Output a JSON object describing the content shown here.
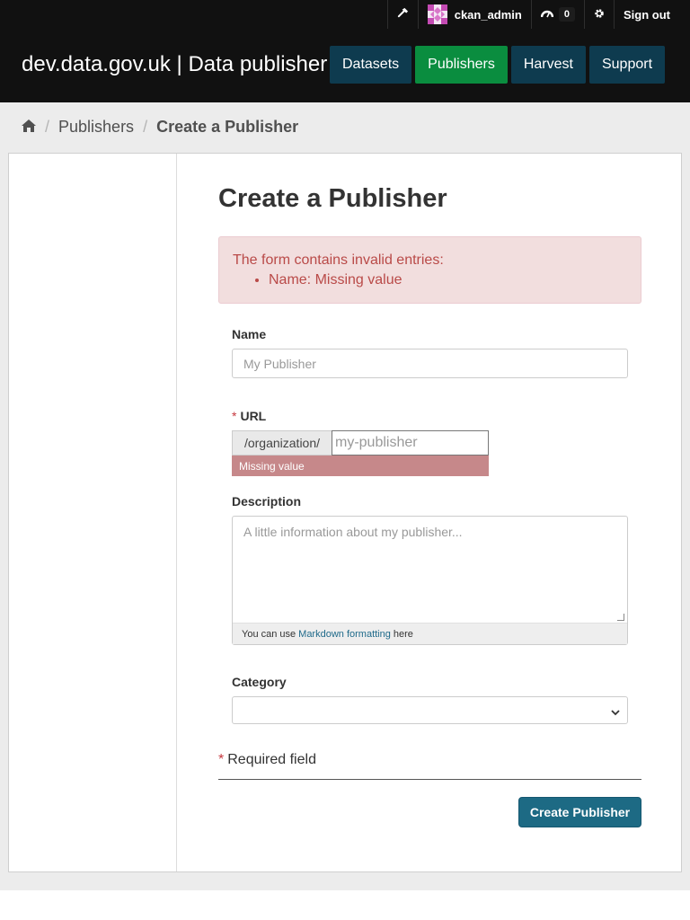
{
  "account": {
    "username": "ckan_admin",
    "activity_count": "0",
    "signout_label": "Sign out"
  },
  "site": {
    "title": "dev.data.gov.uk | Data publisher"
  },
  "nav": {
    "items": [
      {
        "label": "Datasets"
      },
      {
        "label": "Publishers"
      },
      {
        "label": "Harvest"
      },
      {
        "label": "Support"
      }
    ],
    "active_index": 1
  },
  "breadcrumb": {
    "items": [
      "Publishers",
      "Create a Publisher"
    ]
  },
  "page": {
    "heading": "Create a Publisher"
  },
  "alert": {
    "message": "The form contains invalid entries:",
    "errors": [
      "Name: Missing value"
    ]
  },
  "form": {
    "name": {
      "label": "Name",
      "placeholder": "My Publisher"
    },
    "url": {
      "label": "URL",
      "prefix": "/organization/",
      "placeholder": "my-publisher",
      "error": "Missing value"
    },
    "description": {
      "label": "Description",
      "placeholder": "A little information about my publisher...",
      "hint_pre": "You can use",
      "hint_link": "Markdown formatting",
      "hint_post": "here"
    },
    "category": {
      "label": "Category",
      "selected": ""
    },
    "required_star": "*",
    "required_note": "Required field",
    "submit_label": "Create Publisher"
  },
  "colors": {
    "masthead": "#111111",
    "nav": "#0e3b4f",
    "nav_active": "#0a8d3f",
    "alert_bg": "#f2dede",
    "alert_text": "#b94a48",
    "submit": "#1d6a84"
  },
  "icons": [
    "hammer-icon",
    "avatar-icon",
    "dashboard-icon",
    "gear-icon",
    "home-icon",
    "chevron-down-icon"
  ]
}
